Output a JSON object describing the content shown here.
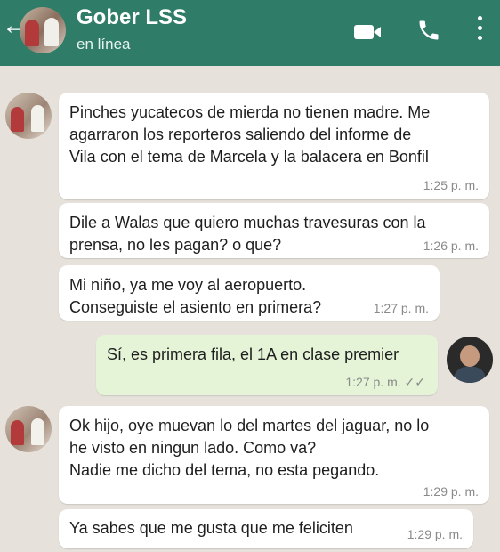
{
  "header": {
    "contact_name": "Gober LSS",
    "status": "en línea",
    "back_glyph": "←",
    "icons": [
      "back-arrow-icon",
      "video-call-icon",
      "phone-icon",
      "more-options-icon"
    ]
  },
  "colors": {
    "header_bg": "#2f7d68",
    "chat_bg": "#e6e1da",
    "incoming_bubble": "#ffffff",
    "outgoing_bubble": "#e5f4d7"
  },
  "messages": [
    {
      "direction": "in",
      "text": "Pinches yucatecos de mierda no tienen madre. Me\nagarraron los reporteros saliendo del informe de\nVila con el tema de Marcela y la balacera en Bonfil",
      "time": "1:25 p. m."
    },
    {
      "direction": "in",
      "text": "Dile a Walas que quiero muchas travesuras con la\nprensa, no les pagan? o que?",
      "time": "1:26 p. m."
    },
    {
      "direction": "in",
      "text": "Mi niño, ya me voy al aeropuerto.\nConseguiste el asiento en primera?",
      "time": "1:27 p. m."
    },
    {
      "direction": "out",
      "text": "Sí, es primera fila, el 1A en clase premier",
      "time": "1:27 p. m.",
      "ticks": "✓✓"
    },
    {
      "direction": "in",
      "text": "Ok hijo, oye muevan lo del martes del jaguar, no lo\nhe visto en ningun lado. Como va?\nNadie me dicho del tema, no esta pegando.",
      "time": "1:29 p. m."
    },
    {
      "direction": "in",
      "text": "Ya sabes que me gusta que me feliciten",
      "time": "1:29 p. m."
    }
  ]
}
